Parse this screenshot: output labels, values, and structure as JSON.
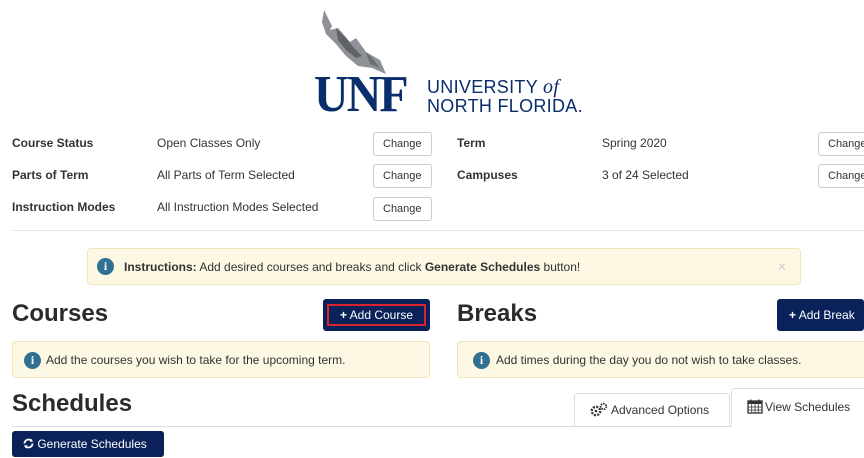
{
  "logo": {
    "mark": "UNF",
    "line1_prefix": "UNIVERSITY",
    "line1_italic": "of",
    "line2": "NORTH FLORIDA."
  },
  "filters": {
    "course_status": {
      "label": "Course Status",
      "value": "Open Classes Only",
      "button": "Change"
    },
    "parts_of_term": {
      "label": "Parts of Term",
      "value": "All Parts of Term Selected",
      "button": "Change"
    },
    "instruction_modes": {
      "label": "Instruction Modes",
      "value": "All Instruction Modes Selected",
      "button": "Change"
    },
    "term": {
      "label": "Term",
      "value": "Spring 2020",
      "button": "Change"
    },
    "campuses": {
      "label": "Campuses",
      "value": "3 of 24 Selected",
      "button": "Change"
    }
  },
  "instructions": {
    "prefix": "Instructions:",
    "text_before": " Add desired courses and breaks and click ",
    "emphasis": "Generate Schedules",
    "text_after": " button!",
    "close": "×"
  },
  "courses": {
    "title": "Courses",
    "add_button": "Add Course",
    "note": "Add the courses you wish to take for the upcoming term."
  },
  "breaks": {
    "title": "Breaks",
    "add_button": "Add Break",
    "note": "Add times during the day you do not wish to take classes."
  },
  "schedules": {
    "title": "Schedules",
    "tabs": [
      {
        "label": "Advanced Options",
        "icon": "gears-icon"
      },
      {
        "label": "View Schedules",
        "icon": "calendar-icon"
      }
    ],
    "generate_button": "Generate Schedules"
  },
  "colors": {
    "navy": "#0a2259",
    "brand_blue": "#0a2e6b",
    "alert_bg": "#fcf8e3",
    "info_blue": "#31708f",
    "focus_red": "#d9232e"
  }
}
